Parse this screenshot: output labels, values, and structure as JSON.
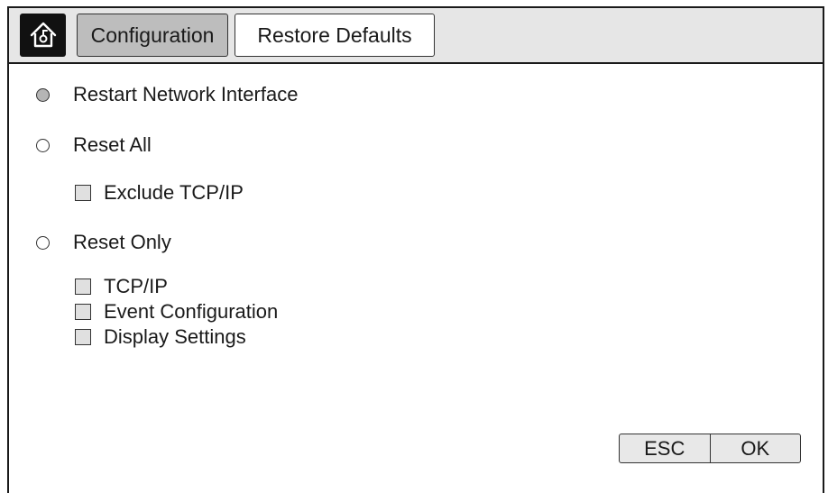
{
  "header": {
    "home_icon": "home-icon",
    "tabs": [
      {
        "label": "Configuration",
        "active": true
      },
      {
        "label": "Restore Defaults",
        "active": false
      }
    ]
  },
  "options": {
    "restart_network": {
      "label": "Restart Network Interface",
      "selected": true
    },
    "reset_all": {
      "label": "Reset All",
      "selected": false
    },
    "exclude_tcpip": {
      "label": "Exclude TCP/IP",
      "checked": false
    },
    "reset_only": {
      "label": "Reset Only",
      "selected": false
    },
    "reset_only_items": [
      {
        "label": "TCP/IP",
        "checked": false
      },
      {
        "label": "Event Configuration",
        "checked": false
      },
      {
        "label": "Display Settings",
        "checked": false
      }
    ]
  },
  "footer": {
    "esc_label": "ESC",
    "ok_label": "OK"
  },
  "colors": {
    "active_tab": "#bdbdbd",
    "header_bg": "#e6e6e6",
    "home_bg": "#111111"
  }
}
